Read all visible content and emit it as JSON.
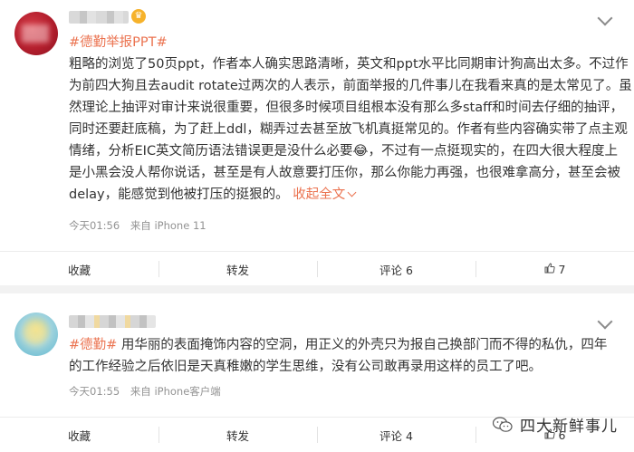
{
  "post1": {
    "hashtag": "#德勤举报PPT#",
    "lines": [
      "粗略的浏览了50页ppt，作者本人确实思路清晰，英文和ppt水平比同期审计狗高出太多。不过作",
      "为前四大狗且去audit rotate过两次的人表示，前面举报的几件事儿在我看来真的是太常见了。虽",
      "然理论上抽评对审计来说很重要，但很多时候项目组根本没有那么多staff和时间去仔细的抽评，",
      "同时还要赶底稿，为了赶上ddl，糊弄过去甚至放飞机真挺常见的。作者有些内容确实带了点主观",
      "情绪，分析EIC英文简历语法错误更是没什么必要😂，不过有一点挺现实的，在四大很大程度上",
      "是小黑会没人帮你说话，甚至是有人故意要打压你，那么你能力再强，也很难拿高分，甚至会被",
      "delay，能感觉到他被打压的挺狠的。"
    ],
    "more_label": "收起全文",
    "time": "今天01:56",
    "source": "来自 iPhone 11",
    "actions": {
      "favorite": "收藏",
      "repost": "转发",
      "comment": "评论 6",
      "like": "7"
    }
  },
  "post2": {
    "hashtag": "#德勤#",
    "lines": [
      " 用华丽的表面掩饰内容的空洞，用正义的外壳只为报自己换部门而不得的私仇，四年",
      "的工作经验之后依旧是天真稚嫩的学生思维，没有公司敢再录用这样的员工了吧。"
    ],
    "time": "今天01:55",
    "source": "来自 iPhone客户端",
    "actions": {
      "favorite": "收藏",
      "repost": "转发",
      "comment": "评论 4",
      "like": "6"
    }
  },
  "watermark": "四大新鲜事儿",
  "colors": {
    "accent": "#eb7350",
    "meta": "#939393"
  }
}
